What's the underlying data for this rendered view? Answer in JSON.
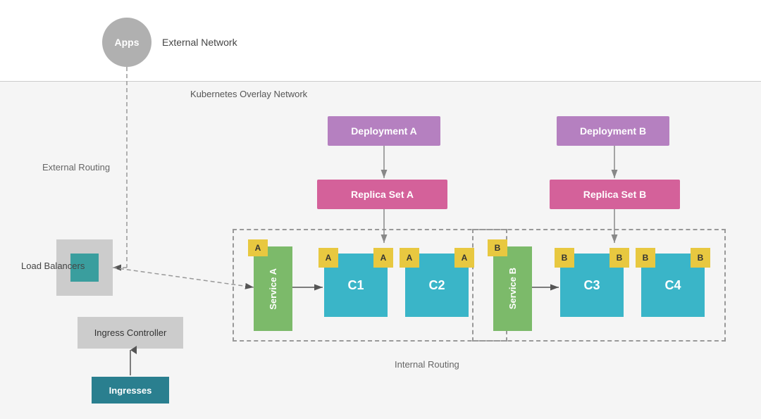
{
  "labels": {
    "apps": "Apps",
    "external_network": "External Network",
    "k8s_overlay": "Kubernetes Overlay Network",
    "external_routing": "External Routing",
    "load_balancers": "Load Balancers",
    "ingress_controller": "Ingress Controller",
    "ingresses": "Ingresses",
    "deployment_a": "Deployment A",
    "deployment_b": "Deployment B",
    "replica_set_a": "Replica Set A",
    "replica_set_b": "Replica Set B",
    "service_a": "Service A",
    "service_b": "Service B",
    "c1": "C1",
    "c2": "C2",
    "c3": "C3",
    "c4": "C4",
    "tag_a": "A",
    "tag_b": "B",
    "internal_routing": "Internal Routing"
  },
  "colors": {
    "deployment": "#b580c0",
    "replica_set": "#d4619a",
    "service": "#7cba6a",
    "container": "#3ab5c8",
    "tag": "#e8c840",
    "ingresses": "#2a7f8f",
    "load_balancer_inner": "#3a9e9e",
    "load_balancer_outer": "#cccccc",
    "ingress_controller": "#cccccc"
  }
}
